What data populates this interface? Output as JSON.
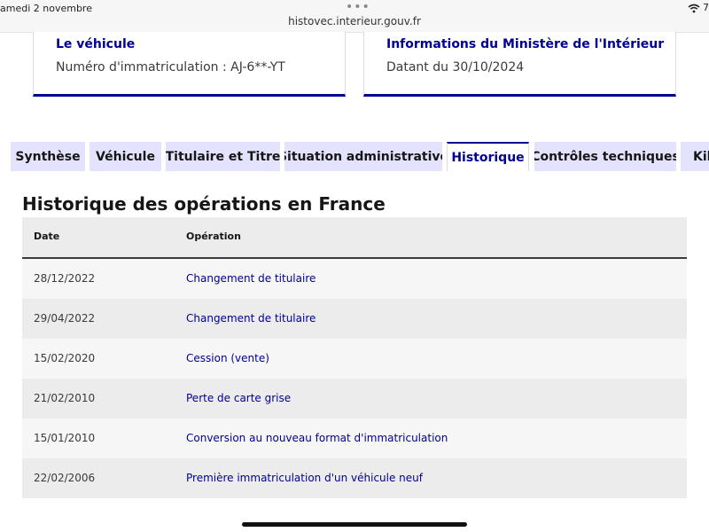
{
  "status_bar": {
    "time": "amedi 2 novembre",
    "url": "histovec.interieur.gouv.fr",
    "more_dots": "•••",
    "battery_text": "7"
  },
  "cards": {
    "vehicle": {
      "title": "Le véhicule",
      "value": "Numéro d'immatriculation : AJ-6**-YT"
    },
    "ministry": {
      "title": "Informations du Ministère de l'Intérieur",
      "value": "Datant du 30/10/2024"
    }
  },
  "tabs": [
    {
      "label": "Synthèse"
    },
    {
      "label": "Véhicule"
    },
    {
      "label": "Titulaire et Titre"
    },
    {
      "label": "Situation administrative"
    },
    {
      "label": "Historique"
    },
    {
      "label": "Contrôles techniques"
    },
    {
      "label": "Kilométrage"
    }
  ],
  "active_tab": "Historique",
  "history": {
    "title": "Historique des opérations en France",
    "columns": {
      "date": "Date",
      "operation": "Opération"
    },
    "rows": [
      {
        "date": "28/12/2022",
        "operation": "Changement de titulaire"
      },
      {
        "date": "29/04/2022",
        "operation": "Changement de titulaire"
      },
      {
        "date": "15/02/2020",
        "operation": "Cession (vente)"
      },
      {
        "date": "21/02/2010",
        "operation": "Perte de carte grise"
      },
      {
        "date": "15/01/2010",
        "operation": "Conversion au nouveau format d'immatriculation"
      },
      {
        "date": "22/02/2006",
        "operation": "Première immatriculation d'un véhicule neuf"
      }
    ]
  },
  "colors": {
    "primary": "#000091",
    "tab_bg": "#e3e3fd",
    "row_alt": "#ececec"
  }
}
